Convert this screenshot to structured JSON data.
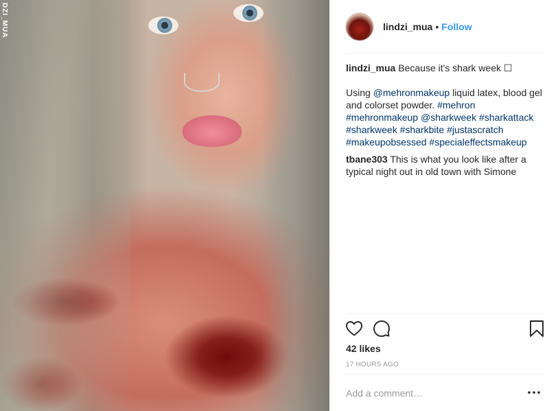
{
  "photo": {
    "watermark": "DZI_MUA"
  },
  "header": {
    "username": "lindzi_mua",
    "separator": "•",
    "follow_label": "Follow"
  },
  "caption": {
    "username": "lindzi_mua",
    "text_intro": "Because it's shark week",
    "emoji_placeholder": "☐",
    "body_prefix": "Using",
    "mention_1": "@mehronmakeup",
    "body_middle": "liquid latex, blood gel and colorset powder.",
    "hashtag_1": "#mehron",
    "hashtag_2": "#mehronmakeup",
    "mention_2": "@sharkweek",
    "hashtag_3": "#sharkattack",
    "hashtag_4": "#sharkweek",
    "hashtag_5": "#sharkbite",
    "hashtag_6": "#justascratch",
    "hashtag_7": "#makeupobsessed",
    "hashtag_8": "#specialeffectsmakeup"
  },
  "comment": {
    "username": "tbane303",
    "text": "This is what you look like after a typical night out in old town with Simone"
  },
  "actions": {
    "like_icon": "heart-icon",
    "comment_icon": "speech-bubble-icon",
    "save_icon": "bookmark-icon"
  },
  "likes": "42 likes",
  "timestamp": "17 HOURS AGO",
  "add_comment_placeholder": "Add a comment…",
  "more_icon": "ellipsis-icon",
  "colors": {
    "link": "#003569",
    "follow": "#3897f0",
    "muted": "#999999",
    "text": "#262626"
  }
}
